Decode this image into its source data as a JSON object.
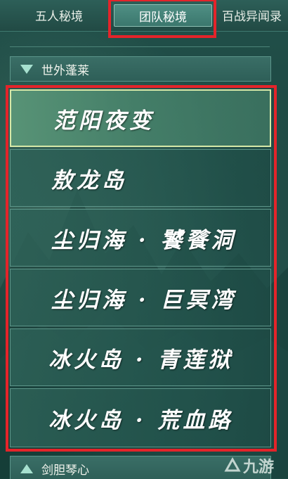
{
  "tabs": [
    {
      "label": "五人秘境",
      "active": false
    },
    {
      "label": "团队秘境",
      "active": true
    },
    {
      "label": "百战异闻录",
      "active": false
    }
  ],
  "sections": {
    "top": {
      "label": "世外蓬莱",
      "state": "expanded"
    },
    "bottom": {
      "label": "剑胆琴心",
      "state": "collapsed"
    }
  },
  "dungeons": [
    {
      "label": "范阳夜变",
      "selected": true
    },
    {
      "label": "敖龙岛",
      "selected": false
    },
    {
      "label": "尘归海 · 饕餮洞",
      "selected": false
    },
    {
      "label": "尘归海 · 巨冥湾",
      "selected": false
    },
    {
      "label": "冰火岛 · 青莲狱",
      "selected": false
    },
    {
      "label": "冰火岛 · 荒血路",
      "selected": false
    }
  ],
  "watermark": {
    "text": "九游"
  },
  "colors": {
    "highlight_frame": "#e4242a",
    "panel_bg": "#1f4a45",
    "tab_active": "#4f8f84",
    "triangle": "#a7e0cf"
  }
}
